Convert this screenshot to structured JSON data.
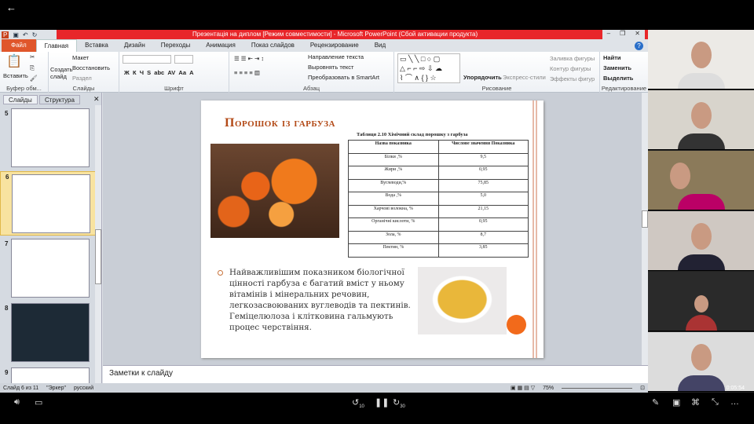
{
  "window": {
    "title": "Презентація на диплом  [Режим совместимости]  -  Microsoft PowerPoint (Сбой активации продукта)"
  },
  "tabs": [
    "Файл",
    "Главная",
    "Вставка",
    "Дизайн",
    "Переходы",
    "Анимация",
    "Показ слайдов",
    "Рецензирование",
    "Вид"
  ],
  "ribbon": {
    "clipboard": {
      "paste": "Вставить",
      "label": "Буфер обм..."
    },
    "slides": {
      "new": "Создать слайд",
      "layout": "Макет",
      "reset": "Восстановить",
      "section": "Раздел",
      "label": "Слайды"
    },
    "font": {
      "label": "Шрифт"
    },
    "paragraph": {
      "direction": "Направление текста",
      "align": "Выровнять текст",
      "smartart": "Преобразовать в SmartArt",
      "label": "Абзац"
    },
    "drawing": {
      "arrange": "Упорядочить",
      "styles": "Экспресс-стили",
      "fill": "Заливка фигуры",
      "outline": "Контур фигуры",
      "effects": "Эффекты фигур",
      "label": "Рисование"
    },
    "editing": {
      "find": "Найти",
      "replace": "Заменить",
      "select": "Выделить",
      "label": "Редактирование"
    }
  },
  "leftpane": {
    "tabs": [
      "Слайды",
      "Структура"
    ],
    "slides": [
      "5",
      "6",
      "7",
      "8",
      "9"
    ],
    "selected": "6"
  },
  "slide": {
    "title": "Порошок із гарбуза",
    "table_caption": "Таблиця 2.10 Хімічний склад порошку з гарбуза",
    "table_headers": [
      "Назва показника",
      "Числове значення Показника"
    ],
    "table_rows": [
      [
        "Білки ,%",
        "9,5"
      ],
      [
        "Жири ,%",
        "0,95"
      ],
      [
        "Вуглеводи,%",
        "75,85"
      ],
      [
        "Вода ,%",
        "5,0"
      ],
      [
        "Харчові волокна, %",
        "21,15"
      ],
      [
        "Органічні кислоти, %",
        "0,95"
      ],
      [
        "Зола, %",
        "8,7"
      ],
      [
        "Пектин, %",
        "3,85"
      ]
    ],
    "bullet": "Найважливішим показником біологічної цінності  гарбуза є багатий вміст у ньому вітамінів і мінеральних речовин, легкозасвоюваних вуглеводів та пектинів. Геміцелюлоза  і клітковина гальмують процес черствіння."
  },
  "notes_placeholder": "Заметки к слайду",
  "status": {
    "slide": "Слайд 6 из 11",
    "theme": "\"Эркер\"",
    "language": "русский",
    "zoom": "75%"
  },
  "video": {
    "elapsed": "0:05:54"
  },
  "player": {
    "rewind": "10",
    "forward": "30"
  },
  "colors": {
    "titlebar": "#e8262a",
    "slide_title": "#b34a17",
    "accent": "#f26a1b"
  }
}
